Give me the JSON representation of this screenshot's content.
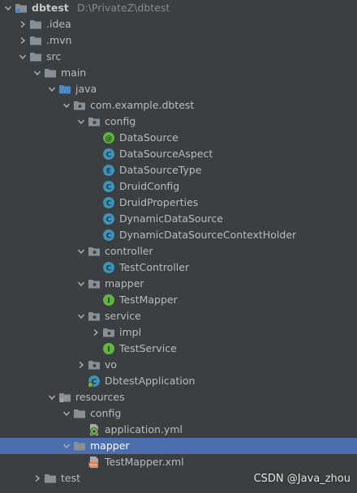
{
  "project_tree": {
    "items": [
      {
        "label": "dbtest",
        "path": "D:\\PrivateZ\\dbtest",
        "depth": 0,
        "icon": "module-folder-icon",
        "arrow": "expanded",
        "selected": false,
        "root": true
      },
      {
        "label": ".idea",
        "depth": 1,
        "icon": "folder-icon",
        "arrow": "collapsed",
        "selected": false
      },
      {
        "label": ".mvn",
        "depth": 1,
        "icon": "folder-icon",
        "arrow": "collapsed",
        "selected": false
      },
      {
        "label": "src",
        "depth": 1,
        "icon": "folder-icon",
        "arrow": "expanded",
        "selected": false
      },
      {
        "label": "main",
        "depth": 2,
        "icon": "folder-icon",
        "arrow": "expanded",
        "selected": false
      },
      {
        "label": "java",
        "depth": 3,
        "icon": "source-folder-icon",
        "arrow": "expanded",
        "selected": false
      },
      {
        "label": "com.example.dbtest",
        "depth": 4,
        "icon": "package-icon",
        "arrow": "expanded",
        "selected": false
      },
      {
        "label": "config",
        "depth": 5,
        "icon": "package-icon",
        "arrow": "expanded",
        "selected": false
      },
      {
        "label": "DataSource",
        "depth": 6,
        "icon": "annotation-icon",
        "arrow": "none",
        "selected": false
      },
      {
        "label": "DataSourceAspect",
        "depth": 6,
        "icon": "class-icon",
        "arrow": "none",
        "selected": false
      },
      {
        "label": "DataSourceType",
        "depth": 6,
        "icon": "enum-icon",
        "arrow": "none",
        "selected": false
      },
      {
        "label": "DruidConfig",
        "depth": 6,
        "icon": "class-icon",
        "arrow": "none",
        "selected": false
      },
      {
        "label": "DruidProperties",
        "depth": 6,
        "icon": "class-icon",
        "arrow": "none",
        "selected": false
      },
      {
        "label": "DynamicDataSource",
        "depth": 6,
        "icon": "class-icon",
        "arrow": "none",
        "selected": false
      },
      {
        "label": "DynamicDataSourceContextHolder",
        "depth": 6,
        "icon": "class-icon",
        "arrow": "none",
        "selected": false
      },
      {
        "label": "controller",
        "depth": 5,
        "icon": "package-icon",
        "arrow": "expanded",
        "selected": false
      },
      {
        "label": "TestController",
        "depth": 6,
        "icon": "class-icon",
        "arrow": "none",
        "selected": false
      },
      {
        "label": "mapper",
        "depth": 5,
        "icon": "package-icon",
        "arrow": "expanded",
        "selected": false
      },
      {
        "label": "TestMapper",
        "depth": 6,
        "icon": "interface-icon",
        "arrow": "none",
        "selected": false
      },
      {
        "label": "service",
        "depth": 5,
        "icon": "package-icon",
        "arrow": "expanded",
        "selected": false
      },
      {
        "label": "impl",
        "depth": 6,
        "icon": "package-icon",
        "arrow": "collapsed",
        "selected": false
      },
      {
        "label": "TestService",
        "depth": 6,
        "icon": "interface-icon",
        "arrow": "none",
        "selected": false
      },
      {
        "label": "vo",
        "depth": 5,
        "icon": "package-icon",
        "arrow": "collapsed",
        "selected": false
      },
      {
        "label": "DbtestApplication",
        "depth": 5,
        "icon": "spring-boot-class-icon",
        "arrow": "none",
        "selected": false
      },
      {
        "label": "resources",
        "depth": 3,
        "icon": "resources-folder-icon",
        "arrow": "expanded",
        "selected": false
      },
      {
        "label": "config",
        "depth": 4,
        "icon": "folder-icon",
        "arrow": "expanded",
        "selected": false
      },
      {
        "label": "application.yml",
        "depth": 5,
        "icon": "spring-yml-icon",
        "arrow": "none",
        "selected": false
      },
      {
        "label": "mapper",
        "depth": 4,
        "icon": "folder-icon",
        "arrow": "expanded",
        "selected": true
      },
      {
        "label": "TestMapper.xml",
        "depth": 5,
        "icon": "xml-file-icon",
        "arrow": "none",
        "selected": false
      },
      {
        "label": "test",
        "depth": 2,
        "icon": "folder-icon",
        "arrow": "collapsed",
        "selected": false
      }
    ]
  },
  "watermark": "CSDN @Java_zhou",
  "colors": {
    "background": "#3c3f41",
    "selection": "#4b6eaf",
    "folder": "#8a8f94",
    "class": "#3d93b8",
    "annotation": "#62b543",
    "interface": "#62b543",
    "xml": "#e2743b"
  }
}
